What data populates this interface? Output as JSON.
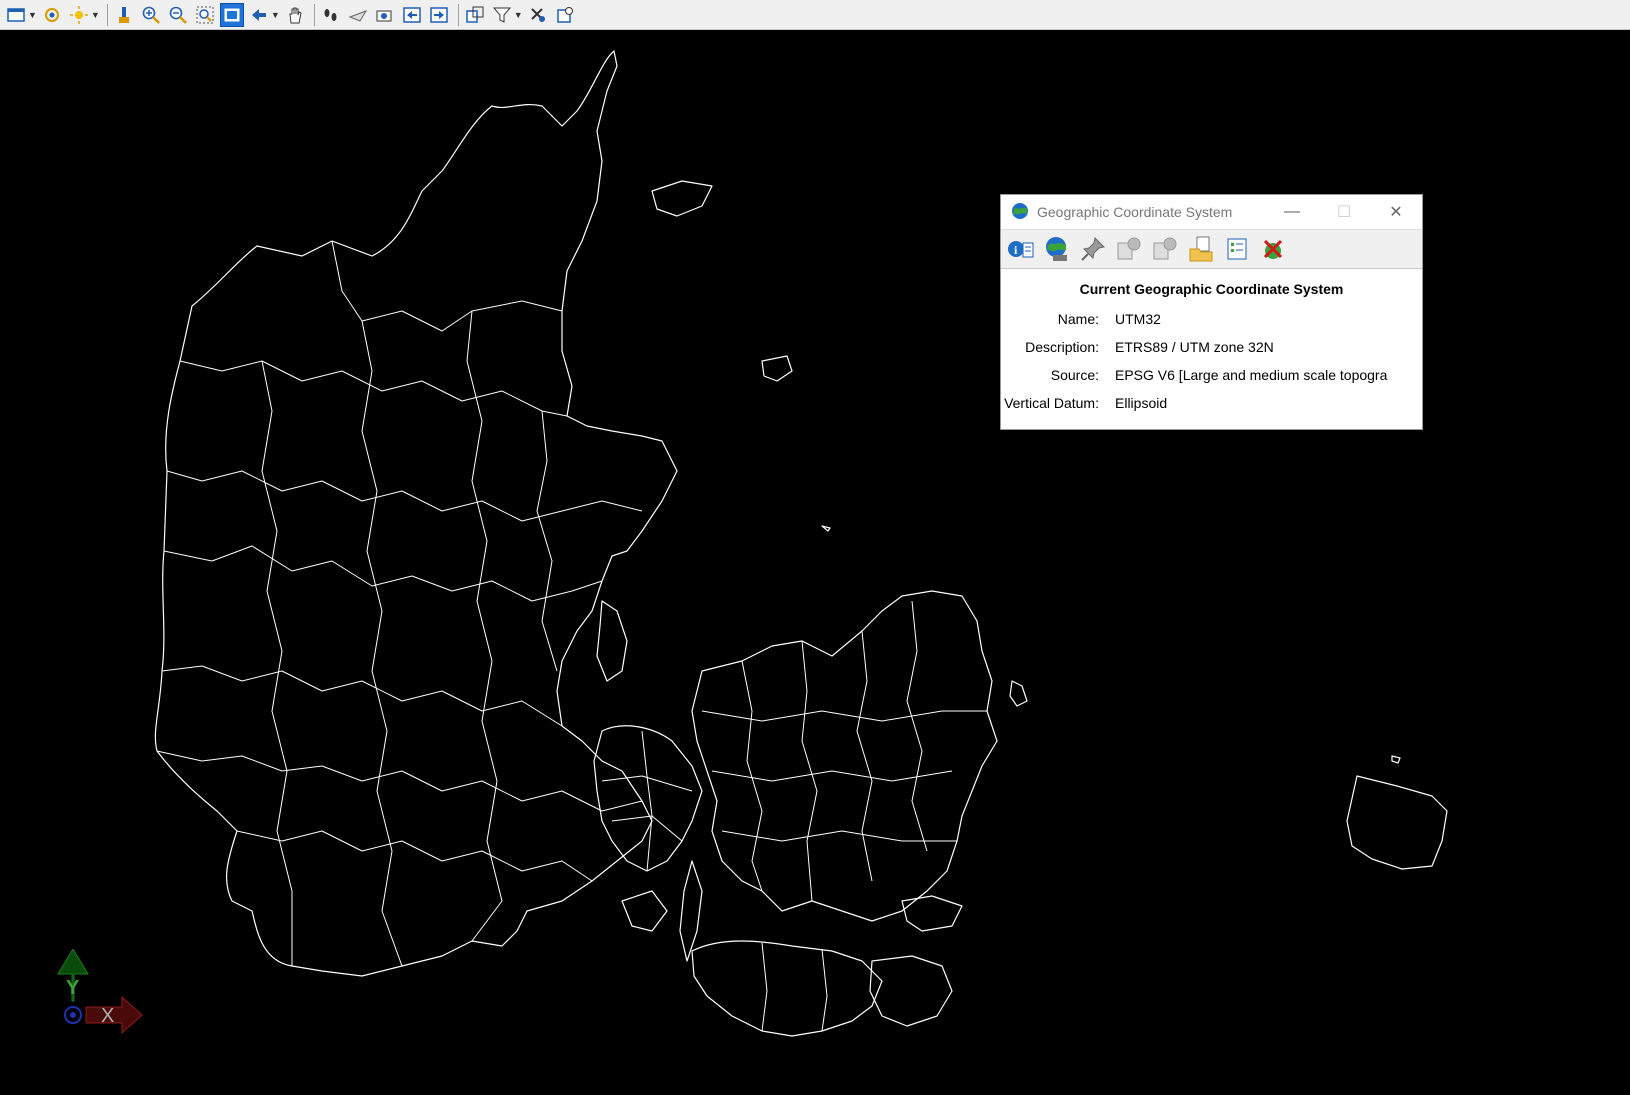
{
  "toolbar": {
    "icons": [
      "view-layout-icon",
      "orbit-icon",
      "light-icon",
      "brush-icon",
      "zoom-in-icon",
      "zoom-out-icon",
      "zoom-window-icon",
      "zoom-extents-icon",
      "zoom-previous-icon",
      "pan-icon",
      "walk-icon",
      "fly-icon",
      "camera-icon",
      "view-back-icon",
      "view-forward-icon",
      "viewport-icon",
      "filter-icon",
      "select-icon",
      "query-icon"
    ]
  },
  "dialog": {
    "title": "Geographic Coordinate System",
    "minimize": "—",
    "maximize": "☐",
    "close": "✕",
    "heading": "Current Geographic Coordinate System",
    "fields": {
      "name_label": "Name:",
      "name_value": "UTM32",
      "description_label": "Description:",
      "description_value": "ETRS89 / UTM zone 32N",
      "source_label": "Source:",
      "source_value": "EPSG V6 [Large and medium scale topogra",
      "datum_label": "Vertical Datum:",
      "datum_value": "Ellipsoid"
    },
    "tool_icons": [
      "info-icon",
      "globe-icon",
      "pin-icon",
      "export-icon",
      "import-icon",
      "open-folder-icon",
      "list-icon",
      "delete-icon"
    ]
  },
  "ucs": {
    "y_label": "Y",
    "x_label": "X"
  },
  "colors": {
    "canvas": "#000000",
    "linework": "#ffffff",
    "toolbar": "#f0f0f0",
    "accent": "#1e74d8"
  }
}
